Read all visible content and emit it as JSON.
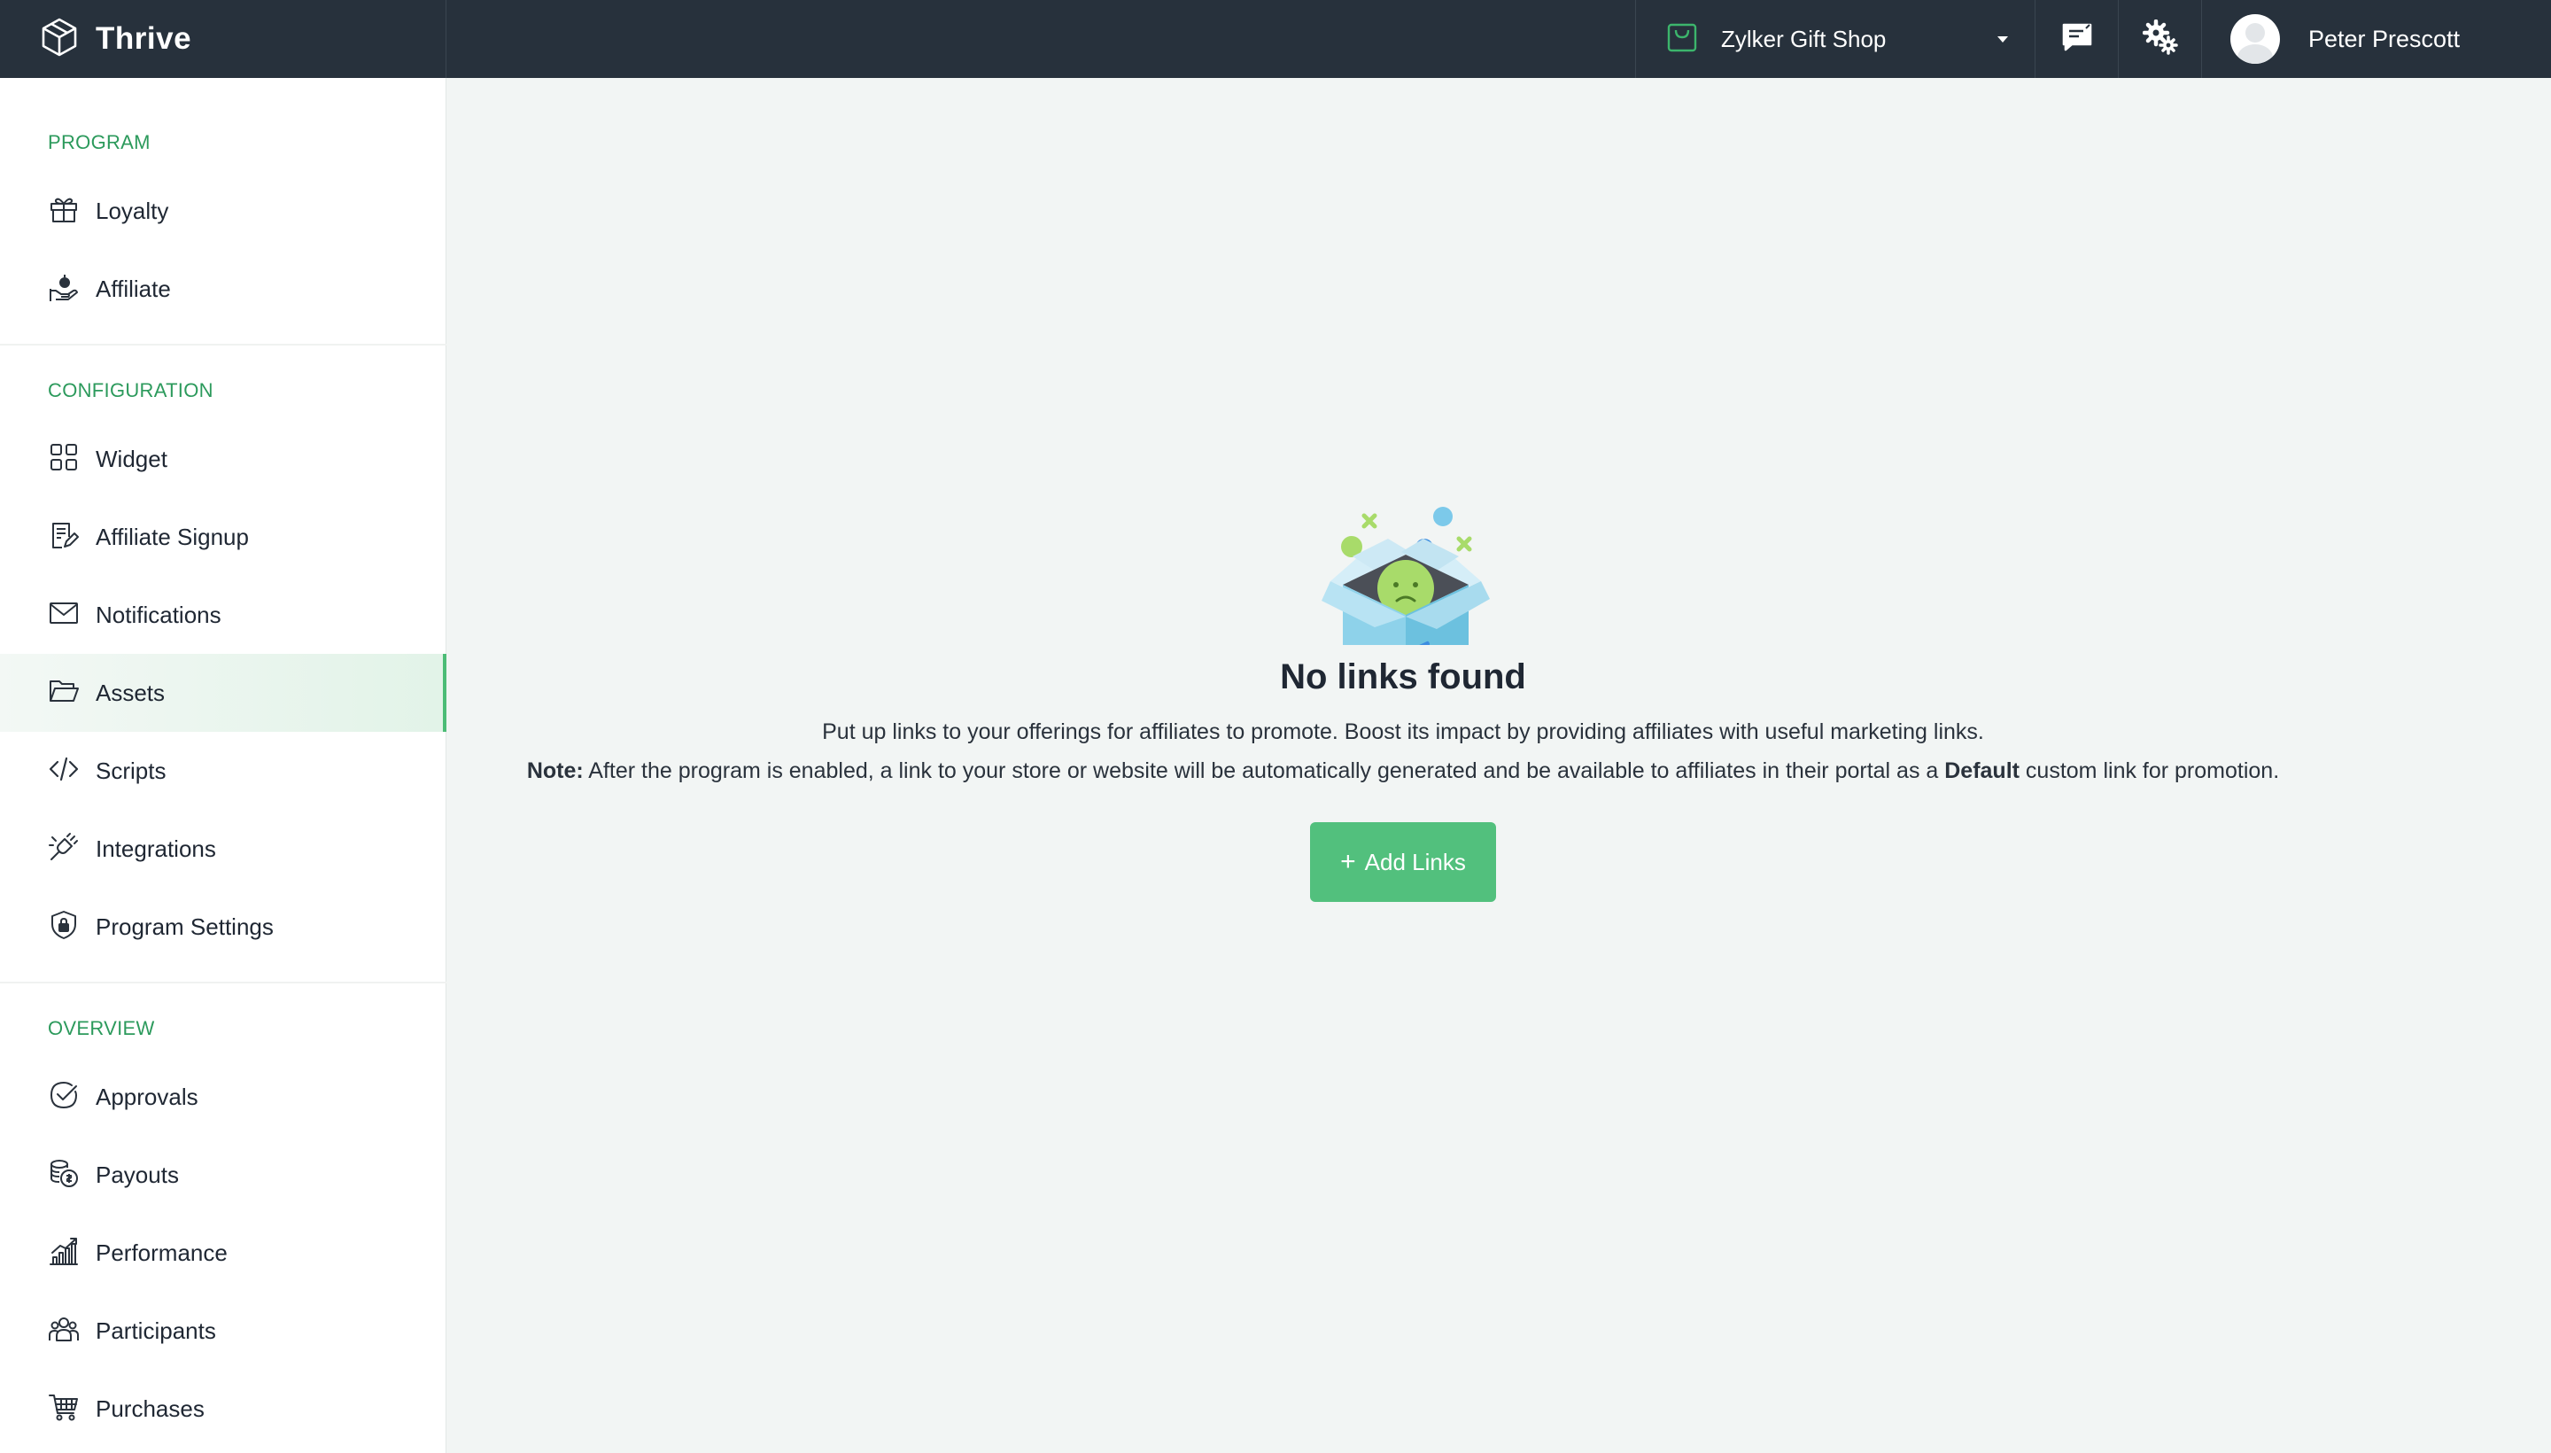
{
  "app": {
    "name": "Thrive"
  },
  "topbar": {
    "store_name": "Zylker Gift Shop",
    "user_name": "Peter Prescott",
    "icons": [
      "thrive-logo-icon",
      "shopping-bag-icon",
      "chat-icon",
      "settings-gears-icon"
    ]
  },
  "sidebar": {
    "sections": [
      {
        "title": "PROGRAM",
        "items": [
          {
            "label": "Loyalty",
            "icon": "gift-icon"
          },
          {
            "label": "Affiliate",
            "icon": "hand-money-icon"
          }
        ]
      },
      {
        "title": "CONFIGURATION",
        "items": [
          {
            "label": "Widget",
            "icon": "widget-grid-icon"
          },
          {
            "label": "Affiliate Signup",
            "icon": "signup-form-icon"
          },
          {
            "label": "Notifications",
            "icon": "envelope-icon"
          },
          {
            "label": "Assets",
            "icon": "folder-icon",
            "active": true
          },
          {
            "label": "Scripts",
            "icon": "code-icon"
          },
          {
            "label": "Integrations",
            "icon": "plug-icon"
          },
          {
            "label": "Program Settings",
            "icon": "shield-lock-icon"
          }
        ]
      },
      {
        "title": "OVERVIEW",
        "items": [
          {
            "label": "Approvals",
            "icon": "check-circle-icon"
          },
          {
            "label": "Payouts",
            "icon": "coins-icon"
          },
          {
            "label": "Performance",
            "icon": "bar-chart-icon"
          },
          {
            "label": "Participants",
            "icon": "people-icon"
          },
          {
            "label": "Purchases",
            "icon": "cart-icon"
          }
        ]
      }
    ]
  },
  "main": {
    "empty_state": {
      "illustration": "empty-box-sad-face-icon",
      "title": "No links found",
      "description": "Put up links to your offerings for affiliates to promote. Boost its impact by providing affiliates with useful marketing links.",
      "note_label": "Note:",
      "note_text_before": " After the program is enabled, a link to your store or website will be automatically generated and be available to affiliates in their portal as a ",
      "note_bold": "Default",
      "note_text_after": " custom link for promotion.",
      "button_label": "Add Links",
      "button_icon": "plus-icon"
    }
  },
  "colors": {
    "topbar_bg": "#27313c",
    "accent_green": "#52c07d",
    "section_title_green": "#2c9a5c",
    "main_bg": "#f2f5f4"
  }
}
